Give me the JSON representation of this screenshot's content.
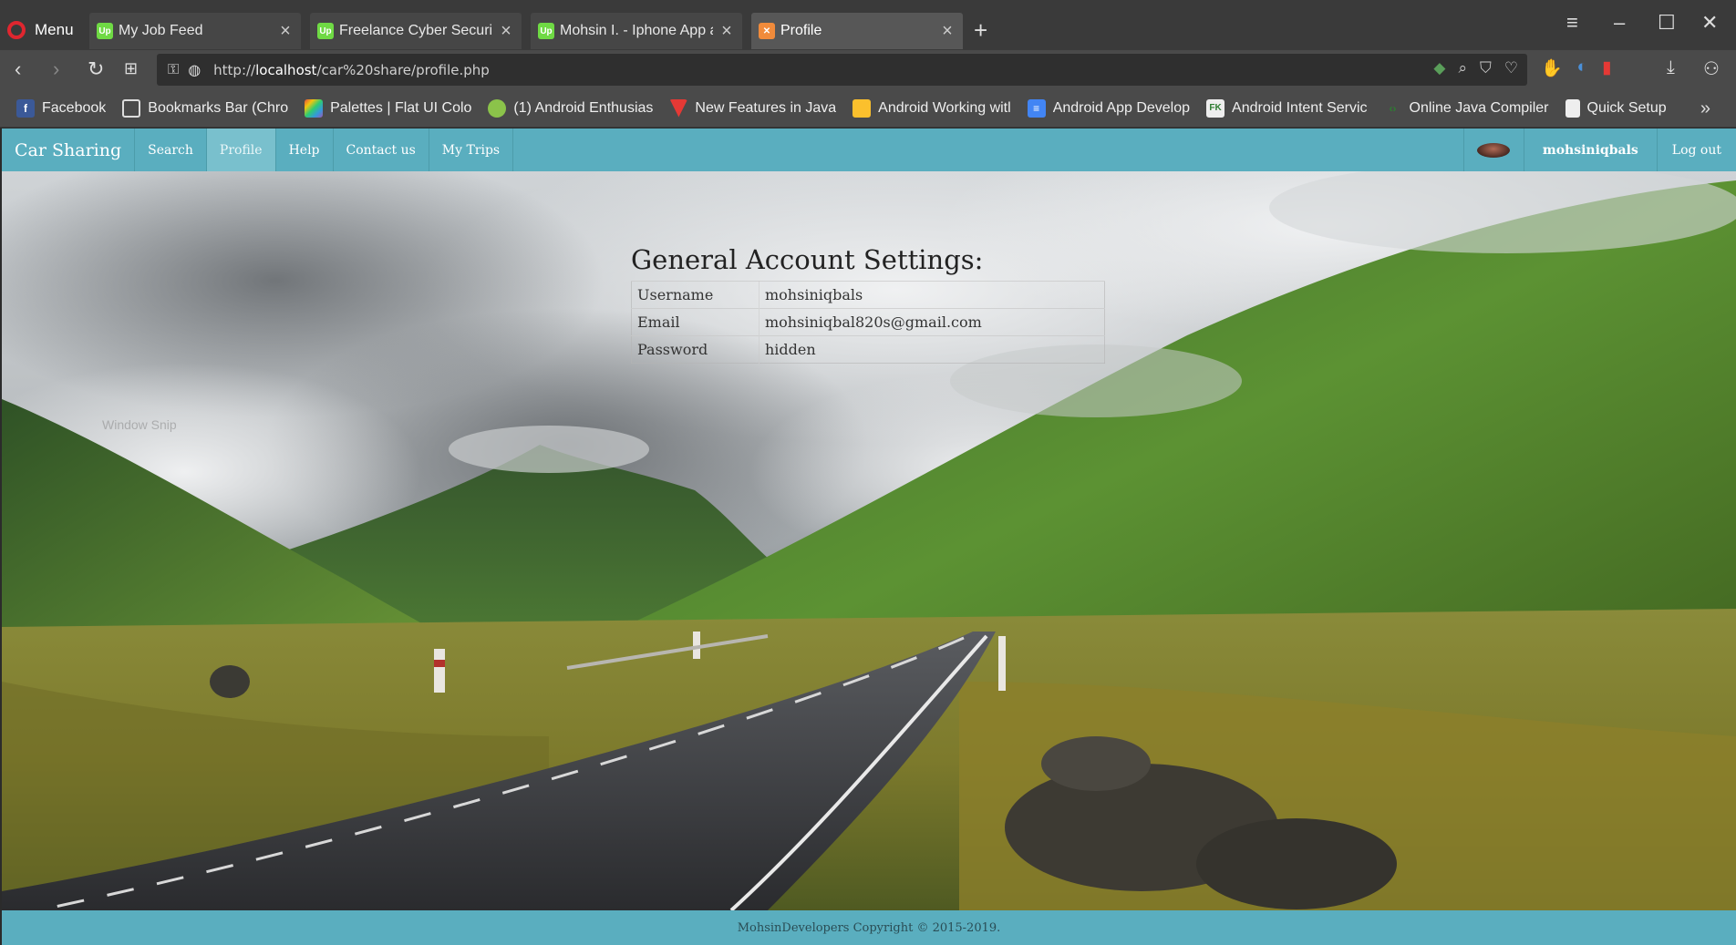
{
  "browser": {
    "menu_label": "Menu",
    "tabs": [
      {
        "title": "My Job Feed",
        "favicon": "upwork-icon"
      },
      {
        "title": "Freelance Cyber Security J",
        "favicon": "upwork-icon"
      },
      {
        "title": "Mohsin I. - Iphone App an",
        "favicon": "upwork-icon"
      },
      {
        "title": "Profile",
        "favicon": "xampp-icon"
      }
    ],
    "url": "http://localhost/car%20share/profile.php",
    "url_prefix": "http://",
    "url_host": "localhost",
    "url_path": "/car%20share/profile.php",
    "bookmarks": [
      {
        "label": "Facebook",
        "icon": "facebook-icon",
        "color": "#3b5998"
      },
      {
        "label": "Bookmarks Bar (Chro",
        "icon": "folder-icon",
        "color": "#888888"
      },
      {
        "label": "Palettes | Flat UI Colo",
        "icon": "palette-icon",
        "color": "#e74c3c"
      },
      {
        "label": "(1) Android Enthusias",
        "icon": "android-icon",
        "color": "#8bc34a"
      },
      {
        "label": "New Features in Java",
        "icon": "java-icon",
        "color": "#e53935"
      },
      {
        "label": "Android Working witl",
        "icon": "android-working-icon",
        "color": "#fbc02d"
      },
      {
        "label": "Android App Develop",
        "icon": "doc-icon",
        "color": "#4285f4"
      },
      {
        "label": "Android Intent Servic",
        "icon": "fk-icon",
        "color": "#2e7d32"
      },
      {
        "label": "Online Java Compiler",
        "icon": "code-icon",
        "color": "#2e7d32"
      },
      {
        "label": "Quick Setup",
        "icon": "page-icon",
        "color": "#dddddd"
      }
    ]
  },
  "navbar": {
    "brand": "Car Sharing",
    "items": [
      "Search",
      "Profile",
      "Help",
      "Contact us",
      "My Trips"
    ],
    "active": "Profile",
    "username": "mohsiniqbals",
    "logout": "Log out"
  },
  "settings": {
    "heading": "General Account Settings:",
    "rows": [
      {
        "label": "Username",
        "value": "mohsiniqbals"
      },
      {
        "label": "Email",
        "value": "mohsiniqbal820s@gmail.com"
      },
      {
        "label": "Password",
        "value": "hidden"
      }
    ]
  },
  "ghost_text": "Window Snip",
  "footer": "MohsinDevelopers Copyright © 2015-2019."
}
